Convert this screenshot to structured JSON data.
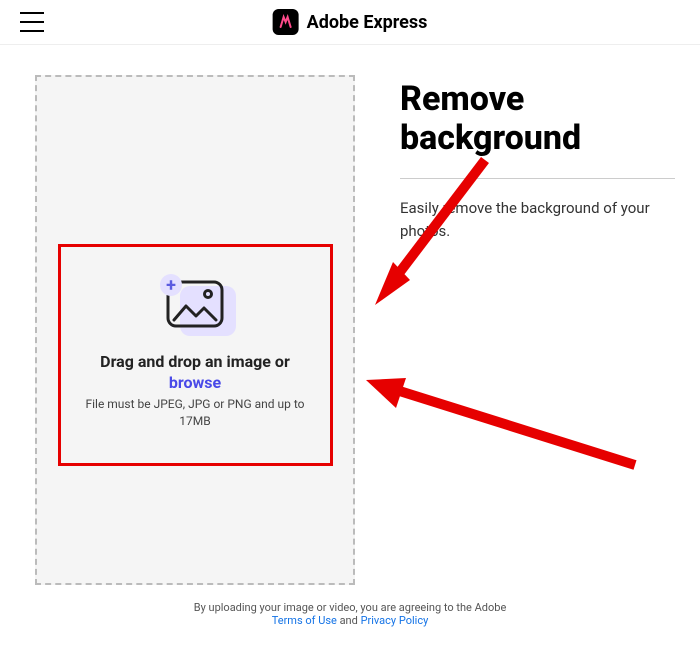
{
  "header": {
    "brand_name": "Adobe Express"
  },
  "dropzone": {
    "title": "Drag and drop an image or",
    "browse_label": "browse",
    "file_hint": "File must be JPEG, JPG or PNG and up to 17MB"
  },
  "main": {
    "title": "Remove background",
    "subtitle": "Easily remove the background of your photos."
  },
  "footer": {
    "prefix": "By uploading your image or video, you are agreeing to the Adobe",
    "terms_label": "Terms of Use",
    "and": " and ",
    "privacy_label": "Privacy Policy"
  }
}
